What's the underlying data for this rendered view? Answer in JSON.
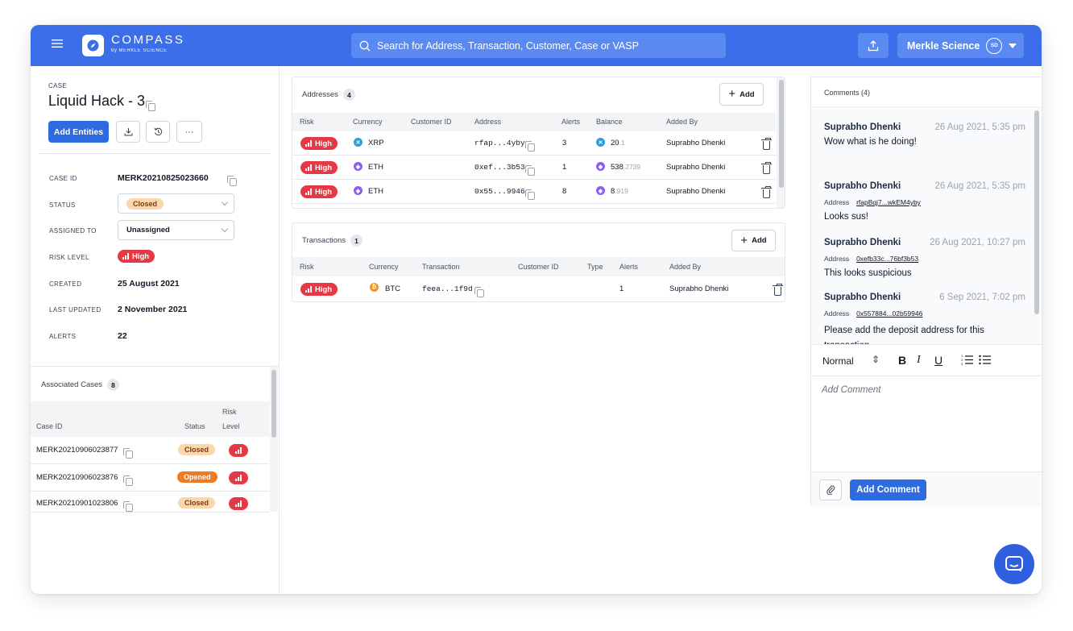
{
  "brand": {
    "name": "COMPASS",
    "byline": "by MERKLE SCIENCE"
  },
  "search": {
    "placeholder": "Search for Address, Transaction, Customer, Case or VASP"
  },
  "org": {
    "name": "Merkle Science",
    "avatar": "SD"
  },
  "case": {
    "eyebrow": "CASE",
    "title": "Liquid Hack - 3",
    "add_entities": "Add Entities",
    "more": "···",
    "fields": {
      "case_id_label": "CASE ID",
      "case_id": "MERK20210825023660",
      "status_label": "STATUS",
      "status": "Closed",
      "assigned_label": "ASSIGNED TO",
      "assigned": "Unassigned",
      "risk_label": "RISK LEVEL",
      "risk": "High",
      "created_label": "CREATED",
      "created": "25 August 2021",
      "updated_label": "LAST UPDATED",
      "updated": "2 November 2021",
      "alerts_label": "ALERTS",
      "alerts": "22"
    }
  },
  "assoc": {
    "title": "Associated Cases",
    "count": "8",
    "col_case": "Case ID",
    "col_status": "Status",
    "col_risk_1": "Risk",
    "col_risk_2": "Level",
    "rows": [
      {
        "id": "MERK20210906023877",
        "status": "Closed"
      },
      {
        "id": "MERK20210906023876",
        "status": "Opened"
      },
      {
        "id": "MERK20210901023806",
        "status": "Closed"
      }
    ]
  },
  "addresses": {
    "title": "Addresses",
    "count": "4",
    "add": "Add",
    "cols": {
      "risk": "Risk",
      "currency": "Currency",
      "customer": "Customer ID",
      "address": "Address",
      "alerts": "Alerts",
      "balance": "Balance",
      "added_by": "Added By"
    },
    "rows": [
      {
        "risk": "High",
        "currency": "XRP",
        "address": "rfap...4yby",
        "alerts": "3",
        "bal_main": "20",
        "bal_dec": ".1",
        "added_by": "Suprabho Dhenki"
      },
      {
        "risk": "High",
        "currency": "ETH",
        "address": "0xef...3b53",
        "alerts": "1",
        "bal_main": "538",
        "bal_dec": ".2739",
        "added_by": "Suprabho Dhenki"
      },
      {
        "risk": "High",
        "currency": "ETH",
        "address": "0x55...9946",
        "alerts": "8",
        "bal_main": "8",
        "bal_dec": ".919",
        "added_by": "Suprabho Dhenki"
      }
    ]
  },
  "transactions": {
    "title": "Transactions",
    "count": "1",
    "add": "Add",
    "cols": {
      "risk": "Risk",
      "currency": "Currency",
      "transaction": "Transaction",
      "customer": "Customer ID",
      "type": "Type",
      "alerts": "Alerts",
      "added_by": "Added By"
    },
    "rows": [
      {
        "risk": "High",
        "currency": "BTC",
        "transaction": "feea...1f9d",
        "alerts": "1",
        "added_by": "Suprabho Dhenki"
      }
    ]
  },
  "comments": {
    "title": "Comments (4)",
    "items": [
      {
        "author": "Suprabho Dhenki",
        "date": "26 Aug 2021, 5:35 pm",
        "text": "Wow what is he doing!"
      },
      {
        "author": "Suprabho Dhenki",
        "date": "26 Aug 2021, 5:35 pm",
        "addr_label": "Address",
        "addr": "rfapBqj7...wkEM4yby",
        "text": "Looks sus!"
      },
      {
        "author": "Suprabho Dhenki",
        "date": "26 Aug 2021, 10:27 pm",
        "addr_label": "Address",
        "addr": "0xefb33c...76bf3b53",
        "text": "This looks suspicious"
      },
      {
        "author": "Suprabho Dhenki",
        "date": "6 Sep 2021, 7:02 pm",
        "addr_label": "Address",
        "addr": "0x557884...02b59946",
        "text": "Please add the deposit address for this transaction"
      }
    ],
    "editor": {
      "style": "Normal",
      "bold": "B",
      "italic": "I",
      "underline": "U",
      "placeholder": "Add Comment",
      "submit": "Add Comment"
    }
  },
  "colors": {
    "primary": "#3b6ee8",
    "high_risk": "#e63946",
    "opened": "#f07a22",
    "closed_bg": "#fbd7ad"
  }
}
